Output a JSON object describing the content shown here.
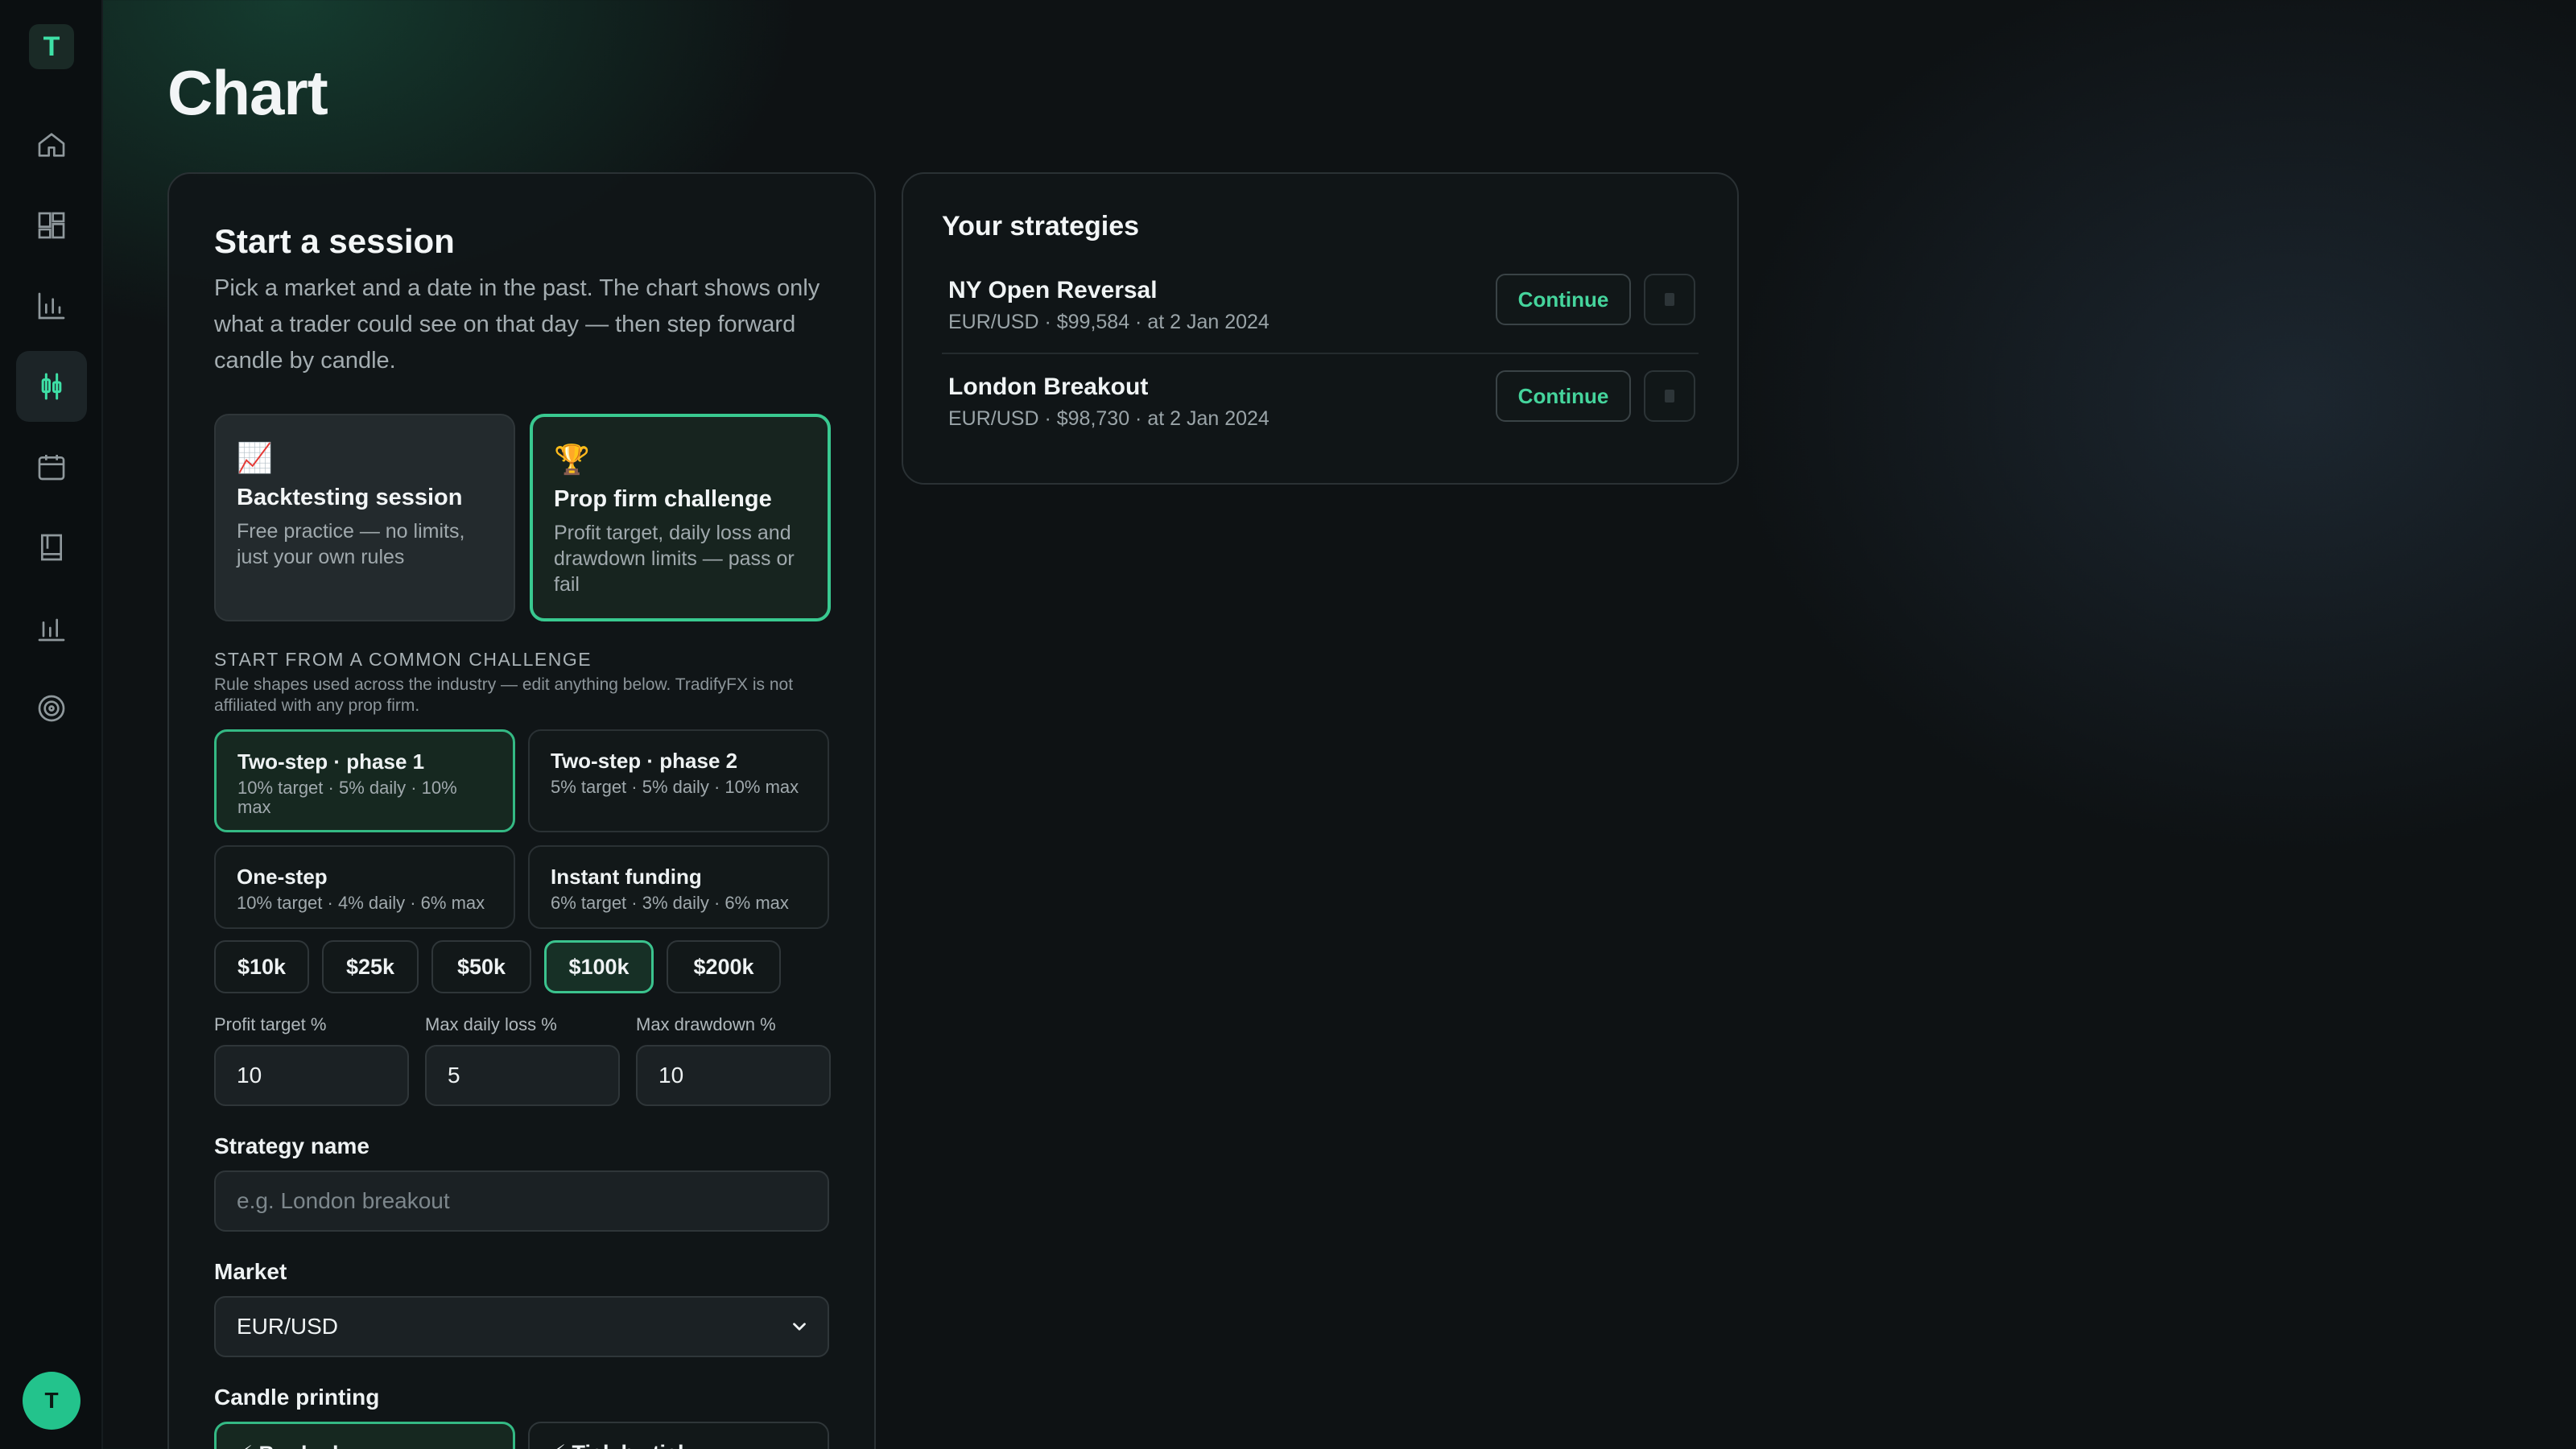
{
  "app": {
    "logo_letter": "T",
    "user_initial": "T"
  },
  "page": {
    "title": "Chart"
  },
  "session": {
    "title": "Start a session",
    "description": "Pick a market and a date in the past. The chart shows only what a trader could see on that day — then step forward candle by candle.",
    "modes": [
      {
        "icon": "📈",
        "title": "Backtesting session",
        "desc": "Free practice — no limits, just your own rules",
        "selected": false
      },
      {
        "icon": "🏆",
        "title": "Prop firm challenge",
        "desc": "Profit target, daily loss and drawdown limits — pass or fail",
        "selected": true
      }
    ],
    "common_challenge": {
      "heading": "START FROM A COMMON CHALLENGE",
      "note": "Rule shapes used across the industry — edit anything below. TradifyFX is not affiliated with any prop firm.",
      "presets": [
        {
          "title": "Two-step · phase 1",
          "desc": "10% target · 5% daily · 10% max",
          "selected": true
        },
        {
          "title": "Two-step · phase 2",
          "desc": "5% target · 5% daily · 10% max",
          "selected": false
        },
        {
          "title": "One-step",
          "desc": "10% target · 4% daily · 6% max",
          "selected": false
        },
        {
          "title": "Instant funding",
          "desc": "6% target · 3% daily · 6% max",
          "selected": false
        }
      ]
    },
    "account_sizes": [
      "$10k",
      "$25k",
      "$50k",
      "$100k",
      "$200k"
    ],
    "selected_size": "$100k",
    "fields": {
      "profit_target_label": "Profit target %",
      "profit_target_value": "10",
      "max_daily_loss_label": "Max daily loss %",
      "max_daily_loss_value": "5",
      "max_drawdown_label": "Max drawdown %",
      "max_drawdown_value": "10"
    },
    "strategy_name": {
      "label": "Strategy name",
      "placeholder": "e.g. London breakout"
    },
    "market": {
      "label": "Market",
      "value": "EUR/USD"
    },
    "candle_printing": {
      "label": "Candle printing",
      "options": [
        "⚡ Bar by bar",
        "⚡ Tick by tick"
      ]
    }
  },
  "strategies": {
    "title": "Your strategies",
    "items": [
      {
        "name": "NY Open Reversal",
        "meta": "EUR/USD · $99,584 · at 2 Jan 2024",
        "action": "Continue"
      },
      {
        "name": "London Breakout",
        "meta": "EUR/USD · $98,730 · at 2 Jan 2024",
        "action": "Continue"
      }
    ]
  },
  "colors": {
    "accent": "#3ee0a6",
    "background": "#0e1214",
    "panel": "#101618"
  }
}
